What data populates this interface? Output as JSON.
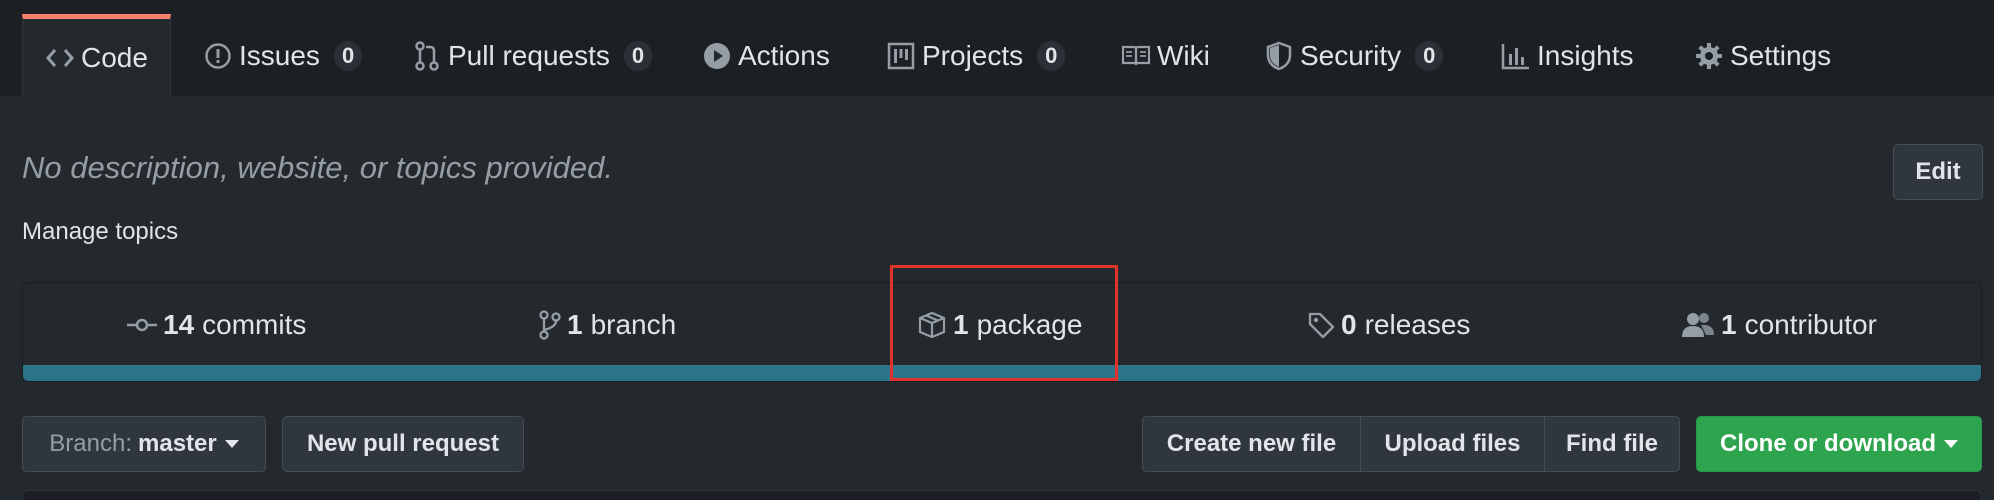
{
  "tabs": [
    {
      "label": "Code",
      "icon": "code-icon",
      "selected": true
    },
    {
      "label": "Issues",
      "icon": "issue-opened-icon",
      "count": "0"
    },
    {
      "label": "Pull requests",
      "icon": "git-pull-request-icon",
      "count": "0"
    },
    {
      "label": "Actions",
      "icon": "play-icon"
    },
    {
      "label": "Projects",
      "icon": "project-icon",
      "count": "0"
    },
    {
      "label": "Wiki",
      "icon": "book-icon"
    },
    {
      "label": "Security",
      "icon": "shield-icon",
      "count": "0"
    },
    {
      "label": "Insights",
      "icon": "graph-icon"
    },
    {
      "label": "Settings",
      "icon": "gear-icon"
    }
  ],
  "repo": {
    "description": "No description, website, or topics provided.",
    "manage_topics": "Manage topics",
    "edit_label": "Edit"
  },
  "summary": {
    "commits": {
      "num": "14",
      "label": "commits",
      "icon": "history-icon"
    },
    "branches": {
      "num": "1",
      "label": "branch",
      "icon": "git-branch-icon"
    },
    "packages": {
      "num": "1",
      "label": "package",
      "icon": "package-icon"
    },
    "releases": {
      "num": "0",
      "label": "releases",
      "icon": "tag-icon"
    },
    "contributors": {
      "num": "1",
      "label": "contributor",
      "icon": "people-icon"
    },
    "language_bar_color": "#2b7489"
  },
  "toolbar": {
    "branch_label": "Branch:",
    "branch_value": "master",
    "new_pr": "New pull request",
    "create_file": "Create new file",
    "upload_files": "Upload files",
    "find_file": "Find file",
    "clone": "Clone or download"
  },
  "colors": {
    "accent_tab": "#f9826c",
    "highlight": "#e0342a",
    "clone_green": "#2ea44f"
  }
}
